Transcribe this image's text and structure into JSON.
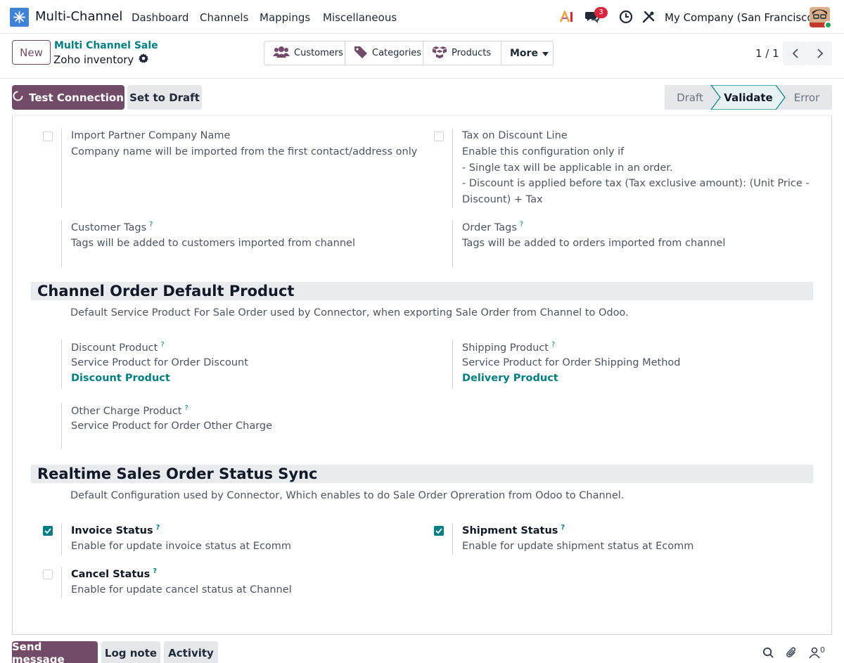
{
  "navbar": {
    "app_name": "Multi-Channel",
    "menus": [
      "Dashboard",
      "Channels",
      "Mappings",
      "Miscellaneous"
    ],
    "messages_count": "3",
    "company": "My Company (San Francisco)"
  },
  "control": {
    "new_label": "New",
    "breadcrumb_parent": "Multi Channel Sale",
    "breadcrumb_current": "Zoho inventory",
    "smart_buttons": [
      "Customers",
      "Categories",
      "Products"
    ],
    "more_label": "More",
    "pager": "1 / 1"
  },
  "status": {
    "test_connection": "Test Connection",
    "set_to_draft": "Set to Draft",
    "stages": [
      "Draft",
      "Validate",
      "Error"
    ],
    "active_stage": "Validate"
  },
  "fields": {
    "import_partner": {
      "label": "Import Partner Company Name",
      "desc": "Company name will be imported from the first contact/address only",
      "checked": false
    },
    "tax_discount": {
      "label": "Tax on Discount Line",
      "desc_lines": [
        "Enable this configuration only if",
        "- Single tax will be applicable in an order.",
        "- Discount is applied before tax (Tax exclusive amount): (Unit Price -",
        "Discount) + Tax"
      ],
      "checked": false
    },
    "customer_tags": {
      "label": "Customer Tags",
      "help": "?",
      "desc": "Tags will be added to customers imported from channel"
    },
    "order_tags": {
      "label": "Order Tags",
      "help": "?",
      "desc": "Tags will be added to orders imported from channel"
    }
  },
  "section_default_product": {
    "title": "Channel Order Default Product",
    "subtitle": "Default Service Product For Sale Order used by Connector, when exporting Sale Order from Channel to Odoo.",
    "discount": {
      "label": "Discount Product",
      "help": "?",
      "desc": "Service Product for Order Discount",
      "value": "Discount Product"
    },
    "shipping": {
      "label": "Shipping Product",
      "help": "?",
      "desc": "Service Product for Order Shipping Method",
      "value": "Delivery Product"
    },
    "other": {
      "label": "Other Charge Product",
      "help": "?",
      "desc": "Service Product for Order Other Charge"
    }
  },
  "section_status_sync": {
    "title": "Realtime Sales Order Status Sync",
    "subtitle": "Default Configuration used by Connector, Which enables to do Sale Order Opreration from Odoo to Channel.",
    "invoice": {
      "label": "Invoice Status",
      "help": "?",
      "desc": "Enable for update invoice status at Ecomm",
      "checked": true
    },
    "shipment": {
      "label": "Shipment Status",
      "help": "?",
      "desc": "Enable for update shipment status at Ecomm",
      "checked": true
    },
    "cancel": {
      "label": "Cancel Status",
      "help": "?",
      "desc": "Enable for update cancel status at Channel",
      "checked": false
    }
  },
  "chatter": {
    "send_message": "Send message",
    "log_note": "Log note",
    "activity": "Activity",
    "followers_count": "0"
  },
  "colors": {
    "primary": "#714b67",
    "link": "#017e84",
    "badge": "#d7263d"
  }
}
